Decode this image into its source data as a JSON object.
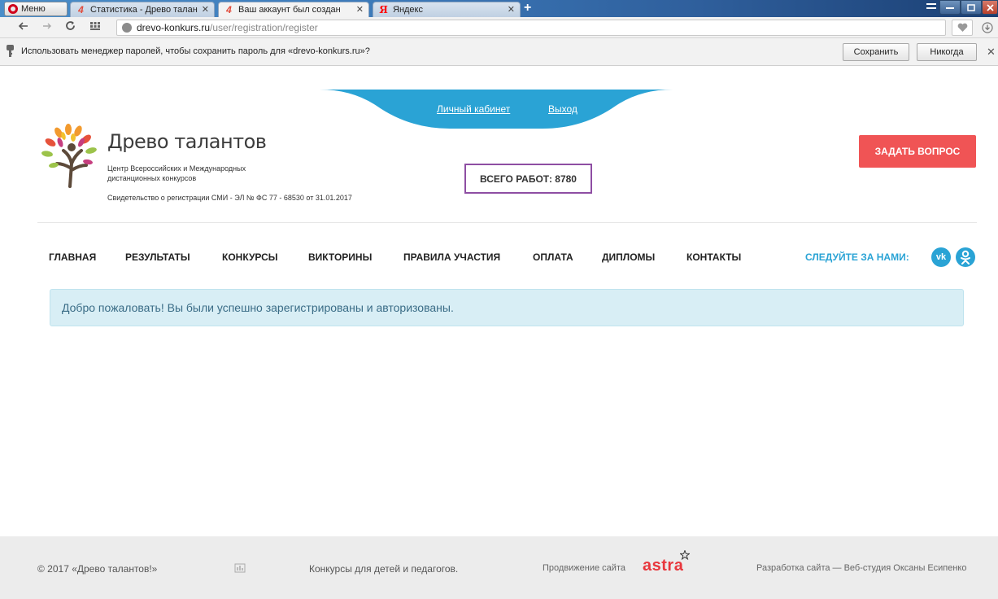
{
  "browser": {
    "menu_label": "Меню",
    "tabs": [
      {
        "title": "Статистика - Древо талан",
        "favicon": "drevo-logo-icon",
        "active": false
      },
      {
        "title": "Ваш аккаунт был создан",
        "favicon": "drevo-logo-icon",
        "active": true
      },
      {
        "title": "Яндекс",
        "favicon": "yandex-icon",
        "active": false
      }
    ],
    "favicon_glyph": "4",
    "yandex_glyph": "Я",
    "close_glyph": "✕",
    "newtab_glyph": "+",
    "url_host": "drevo-konkurs.ru",
    "url_path": "/user/registration/register",
    "password_prompt": {
      "text": "Использовать менеджер паролей, чтобы сохранить пароль для «drevo-konkurs.ru»?",
      "save_label": "Сохранить",
      "never_label": "Никогда"
    }
  },
  "header": {
    "top_links": {
      "cabinet": "Личный кабинет",
      "logout": "Выход"
    },
    "site_name": "Древо талантов",
    "subtitle": "Центр Всероссийских и Международных дистанционных конкурсов",
    "certificate": "Свидетельство о регистрации СМИ - ЭЛ № ФС 77 - 68530 от 31.01.2017",
    "works_total": "ВСЕГО РАБОТ: 8780",
    "ask_button": "ЗАДАТЬ ВОПРОС"
  },
  "nav": {
    "items": [
      "ГЛАВНАЯ",
      "РЕЗУЛЬТАТЫ",
      "КОНКУРСЫ",
      "ВИКТОРИНЫ",
      "ПРАВИЛА УЧАСТИЯ",
      "ОПЛАТА",
      "ДИПЛОМЫ",
      "КОНТАКТЫ"
    ],
    "follow_label": "СЛЕДУЙТЕ ЗА НАМИ:",
    "social": [
      {
        "name": "vk-icon",
        "glyph": "vk"
      },
      {
        "name": "odnoklassniki-icon",
        "glyph": "ok"
      }
    ]
  },
  "alert": {
    "message": "Добро пожаловать! Вы были успешно зарегистрированы и авторизованы."
  },
  "footer": {
    "copyright": "© 2017 «Древо талантов!»",
    "tagline": "Конкурсы для детей и педагогов.",
    "promo_label": "Продвижение сайта",
    "promo_brand": "astra",
    "developer": "Разработка сайта — Веб-студия Оксаны Есипенко"
  },
  "colors": {
    "accent_blue": "#2aa3d5",
    "ask_red": "#f05455",
    "works_border": "#8e4ea3",
    "alert_bg": "#d8eef5"
  }
}
